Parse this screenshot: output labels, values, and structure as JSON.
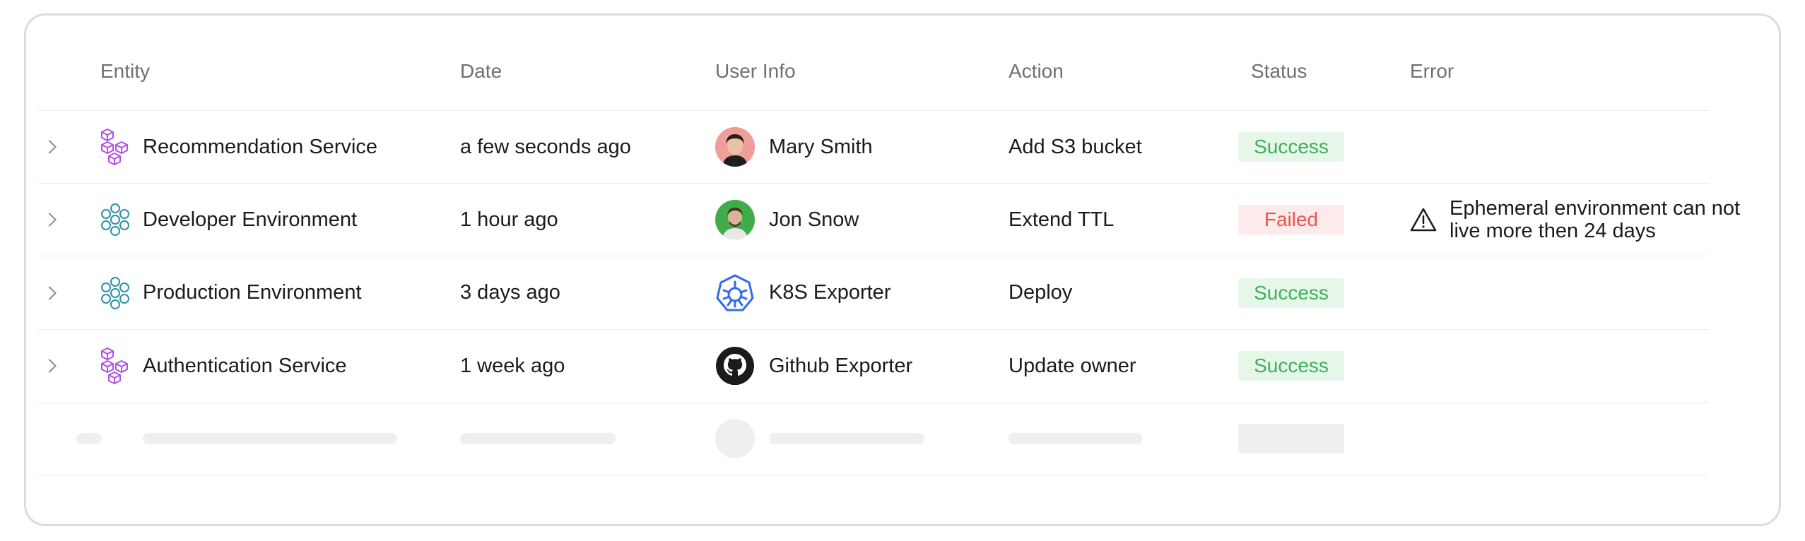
{
  "table": {
    "headers": {
      "entity": "Entity",
      "date": "Date",
      "user_info": "User Info",
      "action": "Action",
      "status": "Status",
      "error": "Error"
    },
    "rows": [
      {
        "entity": "Recommendation Service",
        "entity_icon": "service-cubes-icon",
        "date": "a few seconds ago",
        "user": "Mary Smith",
        "user_avatar": "user-avatar-photo",
        "action": "Add S3 bucket",
        "status": "Success",
        "error": ""
      },
      {
        "entity": "Developer Environment",
        "entity_icon": "environment-hexagons-icon",
        "date": "1 hour ago",
        "user": "Jon Snow",
        "user_avatar": "user-avatar-photo",
        "action": "Extend TTL",
        "status": "Failed",
        "error": "Ephemeral environment can not live more then 24 days"
      },
      {
        "entity": "Production Environment",
        "entity_icon": "environment-hexagons-icon",
        "date": "3 days ago",
        "user": "K8S Exporter",
        "user_avatar": "kubernetes-icon",
        "action": "Deploy",
        "status": "Success",
        "error": ""
      },
      {
        "entity": "Authentication Service",
        "entity_icon": "service-cubes-icon",
        "date": "1 week ago",
        "user": "Github Exporter",
        "user_avatar": "github-icon",
        "action": "Update owner",
        "status": "Success",
        "error": ""
      }
    ]
  },
  "colors": {
    "success_text": "#3cb05c",
    "success_bg": "#e6f7ea",
    "failed_text": "#e8574a",
    "failed_bg": "#fdeaea",
    "service_icon": "#b44ee6",
    "environment_icon": "#2a93a6",
    "kubernetes": "#326ce5"
  }
}
